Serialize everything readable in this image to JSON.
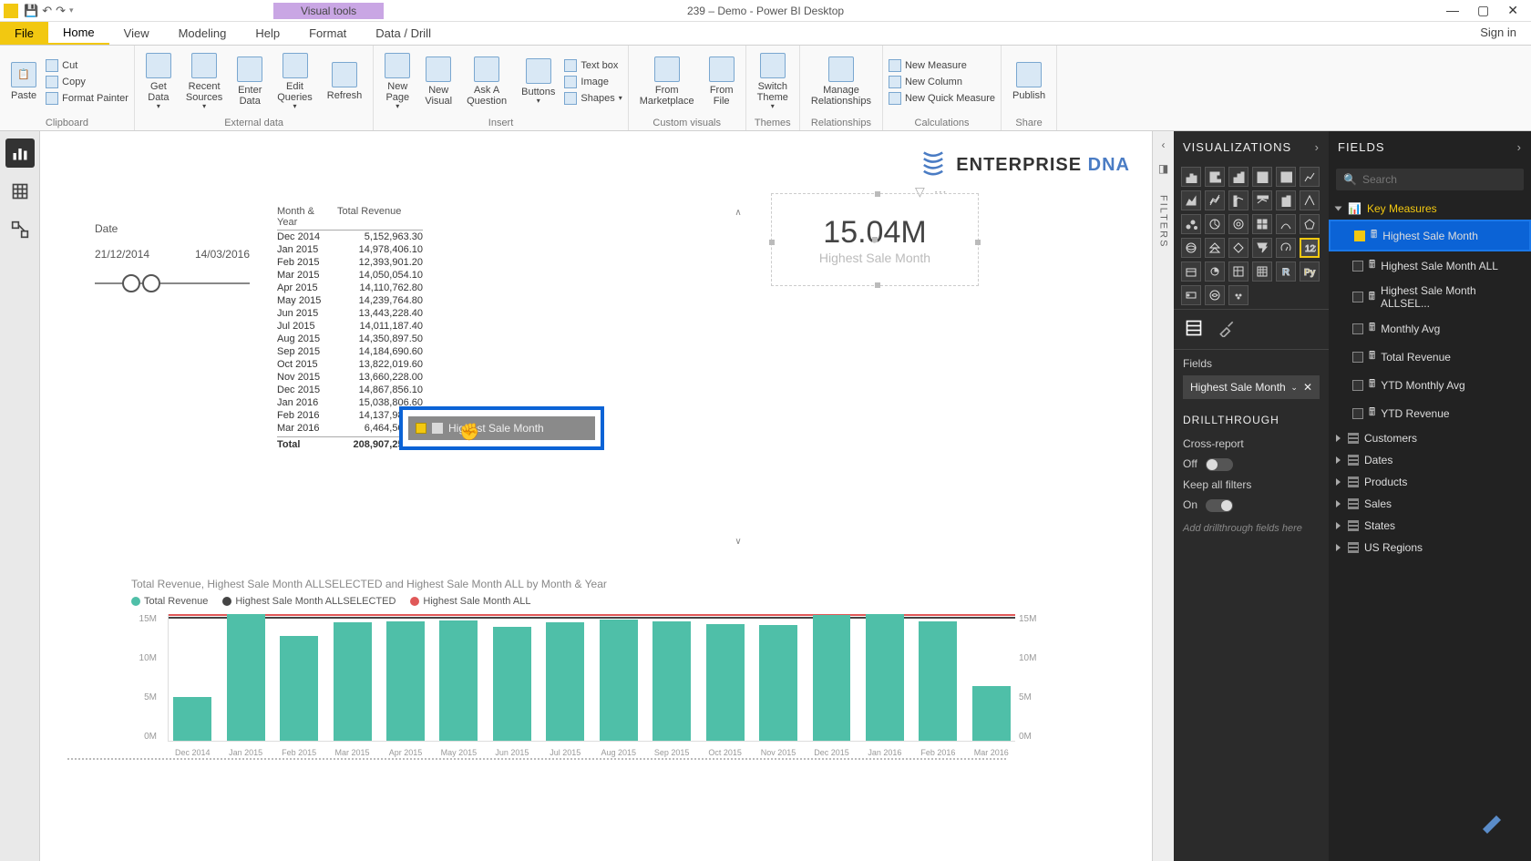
{
  "titlebar": {
    "visual_tools": "Visual tools",
    "title": "239 – Demo - Power BI Desktop"
  },
  "ribbon_tabs": {
    "file": "File",
    "home": "Home",
    "view": "View",
    "modeling": "Modeling",
    "help": "Help",
    "format": "Format",
    "data_drill": "Data / Drill",
    "signin": "Sign in"
  },
  "ribbon": {
    "paste": "Paste",
    "cut": "Cut",
    "copy": "Copy",
    "format_painter": "Format Painter",
    "clipboard": "Clipboard",
    "get_data": "Get\nData",
    "recent_sources": "Recent\nSources",
    "enter_data": "Enter\nData",
    "edit_queries": "Edit\nQueries",
    "refresh": "Refresh",
    "external_data": "External data",
    "new_page": "New\nPage",
    "new_visual": "New\nVisual",
    "ask_question": "Ask A\nQuestion",
    "buttons": "Buttons",
    "text_box": "Text box",
    "image": "Image",
    "shapes": "Shapes",
    "insert": "Insert",
    "from_marketplace": "From\nMarketplace",
    "from_file": "From\nFile",
    "custom_visuals": "Custom visuals",
    "switch_theme": "Switch\nTheme",
    "themes": "Themes",
    "manage_relationships": "Manage\nRelationships",
    "relationships": "Relationships",
    "new_measure": "New Measure",
    "new_column": "New Column",
    "new_quick_measure": "New Quick Measure",
    "calculations": "Calculations",
    "publish": "Publish",
    "share": "Share"
  },
  "date_slicer": {
    "title": "Date",
    "from": "21/12/2014",
    "to": "14/03/2016"
  },
  "table": {
    "h1": "Month & Year",
    "h2": "Total Revenue",
    "rows": [
      {
        "m": "Dec 2014",
        "v": "5,152,963.30"
      },
      {
        "m": "Jan 2015",
        "v": "14,978,406.10"
      },
      {
        "m": "Feb 2015",
        "v": "12,393,901.20"
      },
      {
        "m": "Mar 2015",
        "v": "14,050,054.10"
      },
      {
        "m": "Apr 2015",
        "v": "14,110,762.80"
      },
      {
        "m": "May 2015",
        "v": "14,239,764.80"
      },
      {
        "m": "Jun 2015",
        "v": "13,443,228.40"
      },
      {
        "m": "Jul 2015",
        "v": "14,011,187.40"
      },
      {
        "m": "Aug 2015",
        "v": "14,350,897.50"
      },
      {
        "m": "Sep 2015",
        "v": "14,184,690.60"
      },
      {
        "m": "Oct 2015",
        "v": "13,822,019.60"
      },
      {
        "m": "Nov 2015",
        "v": "13,660,228.00"
      },
      {
        "m": "Dec 2015",
        "v": "14,867,856.10"
      },
      {
        "m": "Jan 2016",
        "v": "15,038,806.60"
      },
      {
        "m": "Feb 2016",
        "v": "14,137,984.90"
      },
      {
        "m": "Mar 2016",
        "v": "6,464,508.40"
      }
    ],
    "total_label": "Total",
    "total_value": "208,907,259.60"
  },
  "drag_chip": "Highest Sale Month",
  "card": {
    "value": "15.04M",
    "label": "Highest Sale Month"
  },
  "logo": {
    "text1": "ENTERPRISE ",
    "text2": "DNA"
  },
  "chart_title": "Total Revenue, Highest Sale Month ALLSELECTED and Highest Sale Month ALL by Month & Year",
  "legend": {
    "s1": "Total Revenue",
    "s2": "Highest Sale Month ALLSELECTED",
    "s3": "Highest Sale Month ALL"
  },
  "chart_data": {
    "type": "bar",
    "categories": [
      "Dec 2014",
      "Jan 2015",
      "Feb 2015",
      "Mar 2015",
      "Apr 2015",
      "May 2015",
      "Jun 2015",
      "Jul 2015",
      "Aug 2015",
      "Sep 2015",
      "Oct 2015",
      "Nov 2015",
      "Dec 2015",
      "Jan 2016",
      "Feb 2016",
      "Mar 2016"
    ],
    "series": [
      {
        "name": "Total Revenue",
        "color": "#4fbfa8",
        "values": [
          5.15,
          14.98,
          12.39,
          14.05,
          14.11,
          14.24,
          13.44,
          14.01,
          14.35,
          14.18,
          13.82,
          13.66,
          14.87,
          15.04,
          14.14,
          6.46
        ]
      },
      {
        "name": "Highest Sale Month ALLSELECTED",
        "color": "#444",
        "values_constant": 15.04
      },
      {
        "name": "Highest Sale Month ALL",
        "color": "#e05858",
        "values_constant": 15.04
      }
    ],
    "ylabel": "",
    "ylim": [
      0,
      15
    ],
    "yticks_left": [
      "15M",
      "10M",
      "5M",
      "0M"
    ],
    "yticks_right": [
      "15M",
      "10M",
      "5M",
      "0M"
    ]
  },
  "viz_pane": {
    "title": "VISUALIZATIONS",
    "fields_label": "Fields",
    "field_item": "Highest Sale Month",
    "drillthrough": "DRILLTHROUGH",
    "cross_report": "Cross-report",
    "off": "Off",
    "keep_filters": "Keep all filters",
    "on": "On",
    "drill_placeholder": "Add drillthrough fields here"
  },
  "fields_pane": {
    "title": "FIELDS",
    "search_placeholder": "Search",
    "key_measures": "Key Measures",
    "m_highest": "Highest Sale Month",
    "m_highest_all": "Highest Sale Month ALL",
    "m_highest_allsel": "Highest Sale Month ALLSEL...",
    "m_monthly_avg": "Monthly Avg",
    "m_total_revenue": "Total Revenue",
    "m_ytd_monthly_avg": "YTD Monthly Avg",
    "m_ytd_revenue": "YTD Revenue",
    "t_customers": "Customers",
    "t_dates": "Dates",
    "t_products": "Products",
    "t_sales": "Sales",
    "t_states": "States",
    "t_us_regions": "US Regions"
  },
  "filters_label": "FILTERS"
}
